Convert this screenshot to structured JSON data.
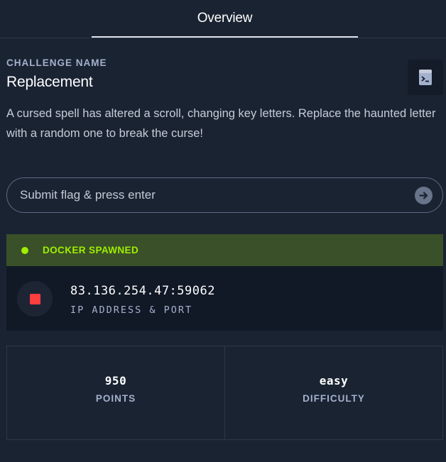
{
  "tabs": [
    {
      "label": "Overview",
      "active": true
    }
  ],
  "challenge": {
    "section_label": "CHALLENGE NAME",
    "name": "Replacement",
    "description": "A cursed spell has altered a scroll, changing key letters. Replace the haunted letter with a random one to break the curse!",
    "terminal_icon": "terminal-icon"
  },
  "flag_input": {
    "placeholder": "Submit flag & press enter",
    "value": "",
    "submit_icon": "arrow-right-circle-icon"
  },
  "docker": {
    "status_text": "DOCKER SPAWNED",
    "status_color": "#9fef00",
    "ip_port": "83.136.254.47:59062",
    "ip_label": "IP ADDRESS & PORT",
    "stop_icon": "stop-icon"
  },
  "stats": [
    {
      "value": "950",
      "label": "POINTS"
    },
    {
      "value": "easy",
      "label": "DIFFICULTY"
    }
  ],
  "colors": {
    "background": "#1a2332",
    "accent": "#9fef00",
    "danger": "#ff3e3e"
  }
}
